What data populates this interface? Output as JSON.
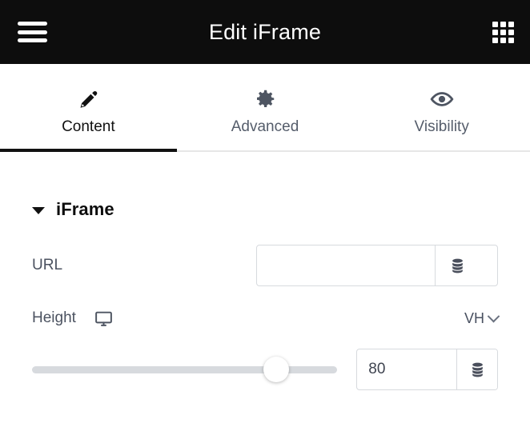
{
  "header": {
    "title": "Edit iFrame",
    "menu_icon": "hamburger-menu-icon",
    "apps_icon": "grid-apps-icon"
  },
  "tabs": [
    {
      "label": "Content",
      "icon": "pencil-icon",
      "active": true
    },
    {
      "label": "Advanced",
      "icon": "gear-icon",
      "active": false
    },
    {
      "label": "Visibility",
      "icon": "eye-icon",
      "active": false
    }
  ],
  "section": {
    "title": "iFrame",
    "expanded": true,
    "caret_icon": "caret-down-icon"
  },
  "fields": {
    "url": {
      "label": "URL",
      "value": "",
      "placeholder": "",
      "dynamic_icon": "database-stack-icon"
    },
    "height": {
      "label": "Height",
      "device_icon": "desktop-monitor-icon",
      "unit": "VH",
      "unit_chevron": "chevron-down-icon",
      "value": "80",
      "slider_percent": 80,
      "dynamic_icon": "database-stack-icon"
    }
  },
  "colors": {
    "header_bg": "#0d0d0d",
    "active_tab": "#111111",
    "muted_text": "#555d6b",
    "icon_gray": "#4e5562",
    "border": "#d7dade",
    "track": "#d7dade"
  }
}
